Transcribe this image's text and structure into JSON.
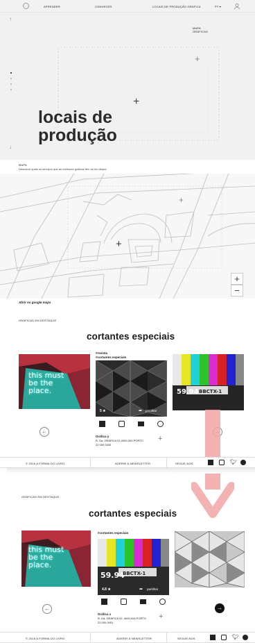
{
  "header": {
    "nav": [
      "APRENDER",
      "CONHECER",
      "LOCAIS DE PRODUÇÃO GRÁFICA"
    ],
    "lang": "PT"
  },
  "hero": {
    "title": "locais de produção",
    "map_label": "MAPA\nGRÁFICAS",
    "scroll_up": "↑",
    "scroll_down": "↓"
  },
  "map": {
    "label": "MAPA",
    "description": "Descobre quais os serviços que as melhores gráficas têm ao teu dispor.",
    "zoom_in": "+",
    "zoom_out": "−",
    "google_link": "Abrir no google maps"
  },
  "featured1": {
    "section_label": "GRÁFICAS EM DESTAQUE",
    "title": "cortantes especiais",
    "tags": [
      "#revista",
      "#cortantes especiais"
    ],
    "rating": "5 ★",
    "share": "partilhar",
    "place_name": "Gráfica y",
    "address": "R. Da. GRÁFICA 01,0000-000 PORTO",
    "phone": "22 000 0000",
    "left_card_text": "this must be the place."
  },
  "footer1": {
    "copyright": "©  2016 A FORMA DO LIVRO",
    "newsletter": "ADERIR À NEWSLETTER",
    "follow": "SEGUE-NOS"
  },
  "featured2": {
    "section_label": "GRÁFICAS EM DESTAQUE",
    "title": "cortantes especiais",
    "tags": [
      "#cortantes especiais"
    ],
    "rating": "4.8 ★",
    "share": "partilhar",
    "place_name": "Gráfica x",
    "address": "R. Da. GRÁFICA 02, 0000-000 PORTO",
    "phone": "22 000 0001",
    "left_card_text": "this must be the place."
  },
  "footer2": {
    "copyright": "©   2016 A FORMA DO LIVRO",
    "newsletter": "ADERIR À NEWSLETTER",
    "follow": "SEGUE-NOS"
  },
  "colors": {
    "arrow": "#f2a6a6",
    "neon": "#3ad0c0",
    "brick": "#c0394a"
  }
}
